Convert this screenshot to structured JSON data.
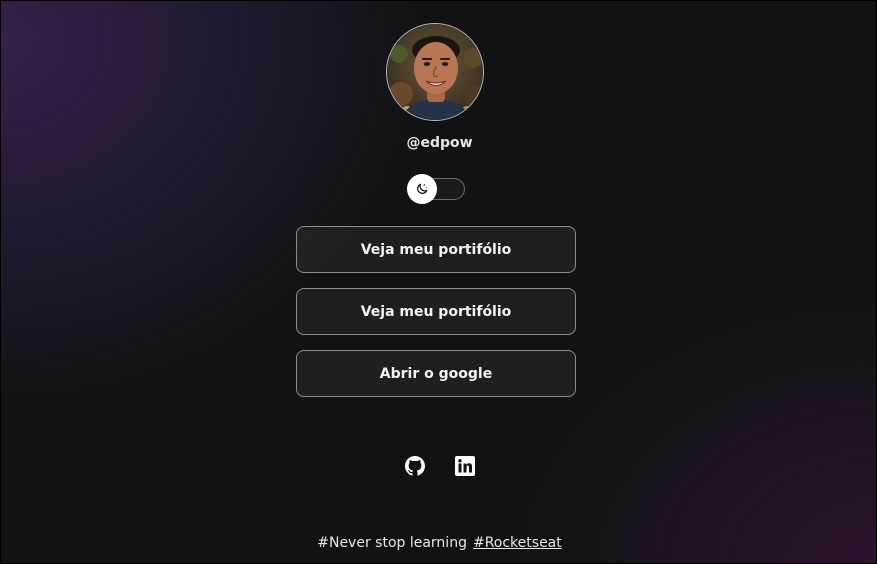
{
  "profile": {
    "username": "@edpow",
    "avatar_alt": "Profile photo"
  },
  "theme_toggle": {
    "icon": "moon-stars-icon",
    "state": "dark"
  },
  "links": [
    {
      "label": "Veja meu portifólio"
    },
    {
      "label": "Veja meu portifólio"
    },
    {
      "label": "Abrir o google"
    }
  ],
  "social": [
    {
      "icon": "github-icon"
    },
    {
      "icon": "linkedin-icon"
    }
  ],
  "footer": {
    "text": "#Never stop learning",
    "link": "#Rocketseat"
  },
  "colors": {
    "background": "#121214",
    "accent_purple": "#3a2458",
    "border": "#8d8d91",
    "text": "#f4f4f5"
  }
}
